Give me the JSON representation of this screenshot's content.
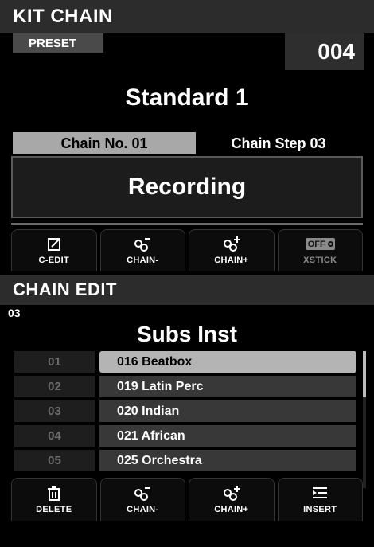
{
  "kit_chain": {
    "title": "KIT CHAIN",
    "preset_label": "PRESET",
    "preset_number": "004",
    "kit_name": "Standard 1",
    "chain_no": "Chain No. 01",
    "chain_step": "Chain Step 03",
    "status": "Recording",
    "buttons": {
      "c_edit": "C-EDIT",
      "chain_minus": "CHAIN-",
      "chain_plus": "CHAIN+",
      "xstick": "XSTICK",
      "xstick_state": "OFF"
    }
  },
  "chain_edit": {
    "title": "CHAIN EDIT",
    "step": "03",
    "instrument_title": "Subs Inst",
    "rows": [
      {
        "num": "01",
        "name": "016  Beatbox",
        "selected": true
      },
      {
        "num": "02",
        "name": "019  Latin Perc"
      },
      {
        "num": "03",
        "name": "020  Indian"
      },
      {
        "num": "04",
        "name": "021  African"
      },
      {
        "num": "05",
        "name": "025  Orchestra"
      }
    ],
    "buttons": {
      "delete": "DELETE",
      "chain_minus": "CHAIN-",
      "chain_plus": "CHAIN+",
      "insert": "INSERT"
    }
  },
  "colors": {
    "selected_row": "#b4b4b4",
    "row_bg": "#383838",
    "title_bg": "#2c2c2c"
  }
}
